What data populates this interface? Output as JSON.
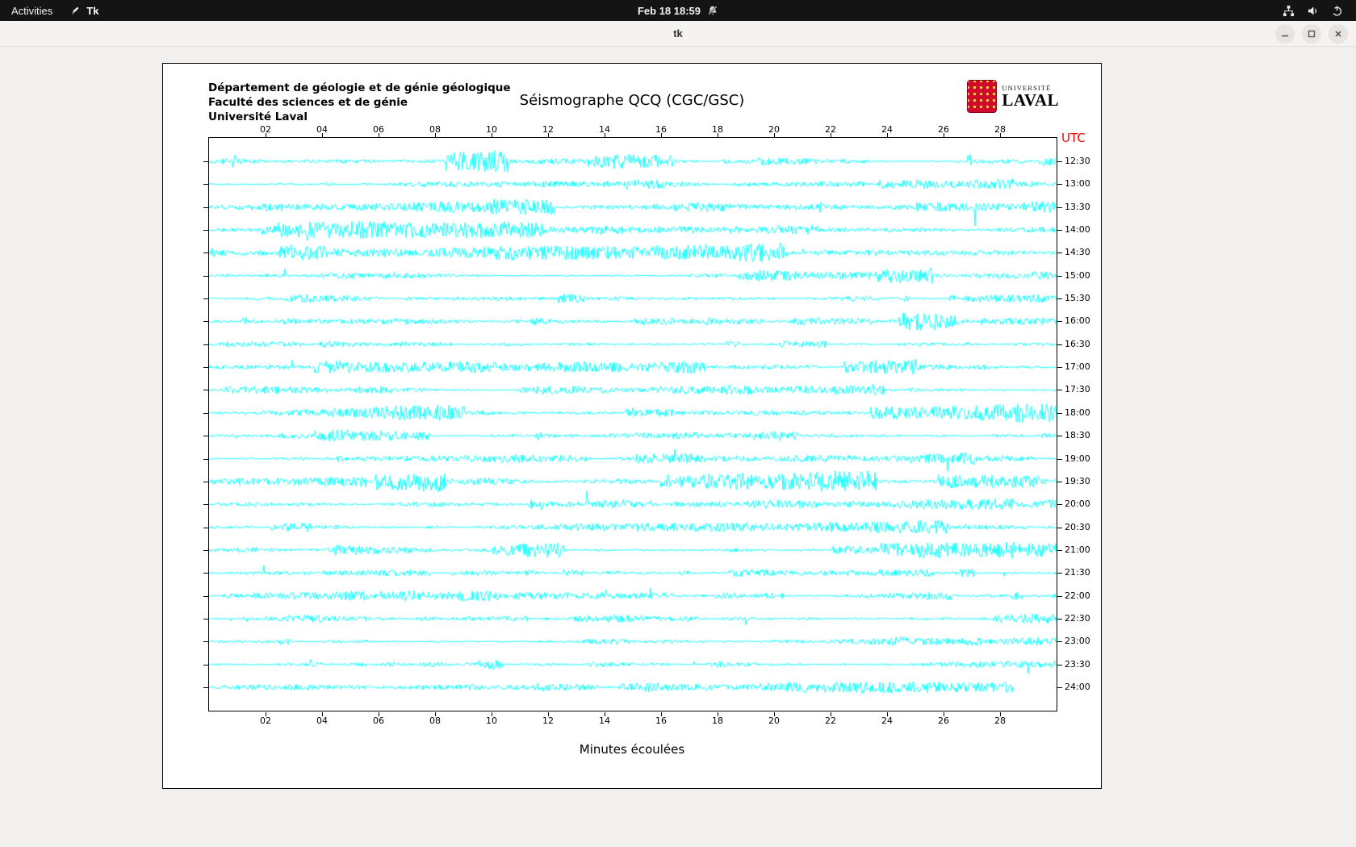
{
  "topbar": {
    "activities": "Activities",
    "app_name": "Tk",
    "clock": "Feb 18 18:59",
    "icons": [
      "tk-icon",
      "notifications-muted-icon",
      "network-icon",
      "volume-icon",
      "power-icon"
    ]
  },
  "window": {
    "title": "tk",
    "controls": [
      "minimize",
      "maximize",
      "close"
    ]
  },
  "seismograph": {
    "org_lines": [
      "Département de géologie et de génie géologique",
      "Faculté des sciences et de génie",
      "Université Laval"
    ],
    "title": "Séismographe QCQ (CGC/GSC)",
    "utc_label": "UTC",
    "xlabel": "Minutes écoulées",
    "x_ticks": [
      "02",
      "04",
      "06",
      "08",
      "10",
      "12",
      "14",
      "16",
      "18",
      "20",
      "22",
      "24",
      "26",
      "28"
    ],
    "time_labels": [
      "12:30",
      "13:00",
      "13:30",
      "14:00",
      "14:30",
      "15:00",
      "15:30",
      "16:00",
      "16:30",
      "17:00",
      "17:30",
      "18:00",
      "18:30",
      "19:00",
      "19:30",
      "20:00",
      "20:30",
      "21:00",
      "21:30",
      "22:00",
      "22:30",
      "23:00",
      "23:30",
      "24:00"
    ],
    "minutes_per_row": 30,
    "trace_color": "#00ffff",
    "render": {
      "seed": 20240218,
      "last_row_fraction": 0.95
    },
    "logo": {
      "line1": "UNIVERSITÉ",
      "line2": "LAVAL"
    }
  }
}
